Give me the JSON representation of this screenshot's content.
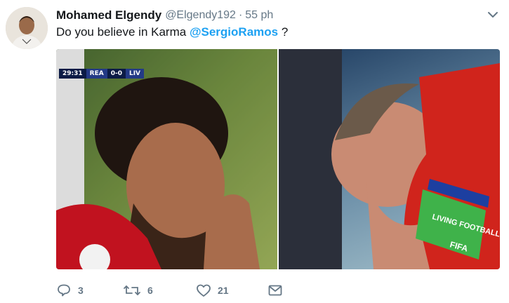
{
  "tweet": {
    "author_name": "Mohamed Elgendy",
    "author_handle": "@Elgendy192",
    "separator": "·",
    "time": "55 ph",
    "text_before": "Do you believe in Karma ",
    "mention": "@SergioRamos",
    "text_after": " ?"
  },
  "media": {
    "scorebug": {
      "time": "29:31",
      "home": "REA",
      "score": "0-0",
      "away": "LIV"
    },
    "captain_band": "LIVING FOOTBALL",
    "band_logo": "FIFA"
  },
  "actions": {
    "replies": "3",
    "retweets": "6",
    "likes": "21"
  },
  "icons": {
    "reply": "reply-icon",
    "retweet": "retweet-icon",
    "like": "heart-icon",
    "dm": "direct-message-icon",
    "menu": "chevron-down-icon"
  },
  "colors": {
    "link": "#1da1f2",
    "muted": "#657786",
    "text": "#14171a"
  }
}
